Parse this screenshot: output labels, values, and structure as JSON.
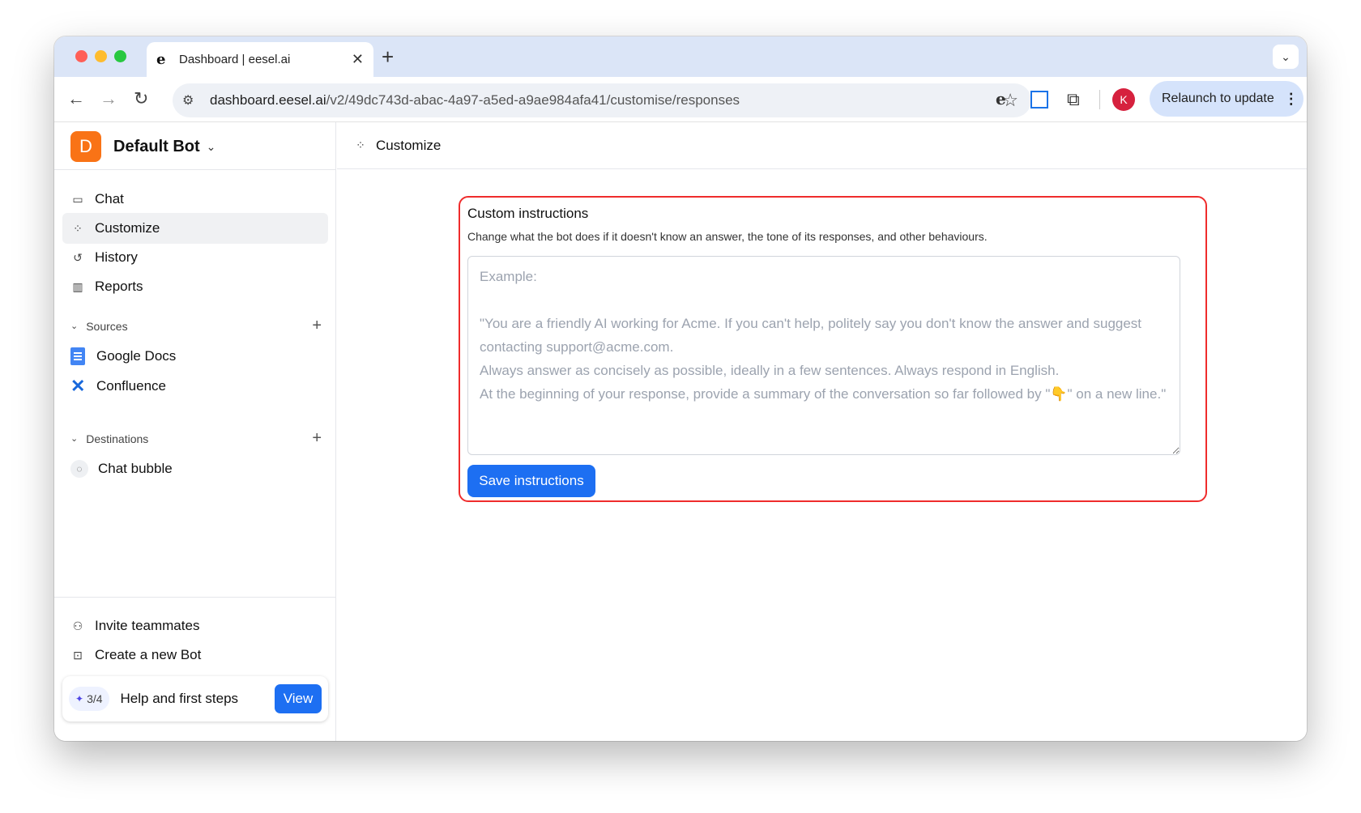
{
  "browser": {
    "tab_title": "Dashboard | eesel.ai",
    "tab_favicon": "e",
    "new_tab": "+",
    "tab_menu": "⌄",
    "url_host": "dashboard.eesel.ai",
    "url_path": "/v2/49dc743d-abac-4a97-a5ed-a9ae984afa41/customise/responses",
    "profile_initial": "K",
    "relaunch_label": "Relaunch to update",
    "extension_e": "e"
  },
  "sidebar": {
    "bot_initial": "D",
    "bot_name": "Default Bot",
    "nav": [
      {
        "label": "Chat",
        "icon": "chat-icon"
      },
      {
        "label": "Customize",
        "icon": "customize-icon"
      },
      {
        "label": "History",
        "icon": "history-icon"
      },
      {
        "label": "Reports",
        "icon": "reports-icon"
      }
    ],
    "sources_label": "Sources",
    "sources": [
      {
        "label": "Google Docs",
        "icon": "google-docs-icon"
      },
      {
        "label": "Confluence",
        "icon": "confluence-icon"
      }
    ],
    "destinations_label": "Destinations",
    "destinations": [
      {
        "label": "Chat bubble",
        "icon": "chat-bubble-icon"
      }
    ],
    "invite_label": "Invite teammates",
    "create_bot_label": "Create a new Bot",
    "help_progress": "3/4",
    "help_label": "Help and first steps",
    "view_label": "View"
  },
  "main": {
    "header_title": "Customize",
    "card_title": "Custom instructions",
    "card_description": "Change what the bot does if it doesn't know an answer, the tone of its responses, and other behaviours.",
    "instructions_value": "",
    "instructions_placeholder": "Example:\n\n\"You are a friendly AI working for Acme. If you can't help, politely say you don't know the answer and suggest contacting support@acme.com.\nAlways answer as concisely as possible, ideally in a few sentences. Always respond in English.\nAt the beginning of your response, provide a summary of the conversation so far followed by \"👇\" on a new line.\"",
    "save_label": "Save instructions"
  },
  "colors": {
    "accent": "#1d6ff2",
    "highlight_border": "#ef2c2c",
    "bot_avatar": "#f97316"
  }
}
